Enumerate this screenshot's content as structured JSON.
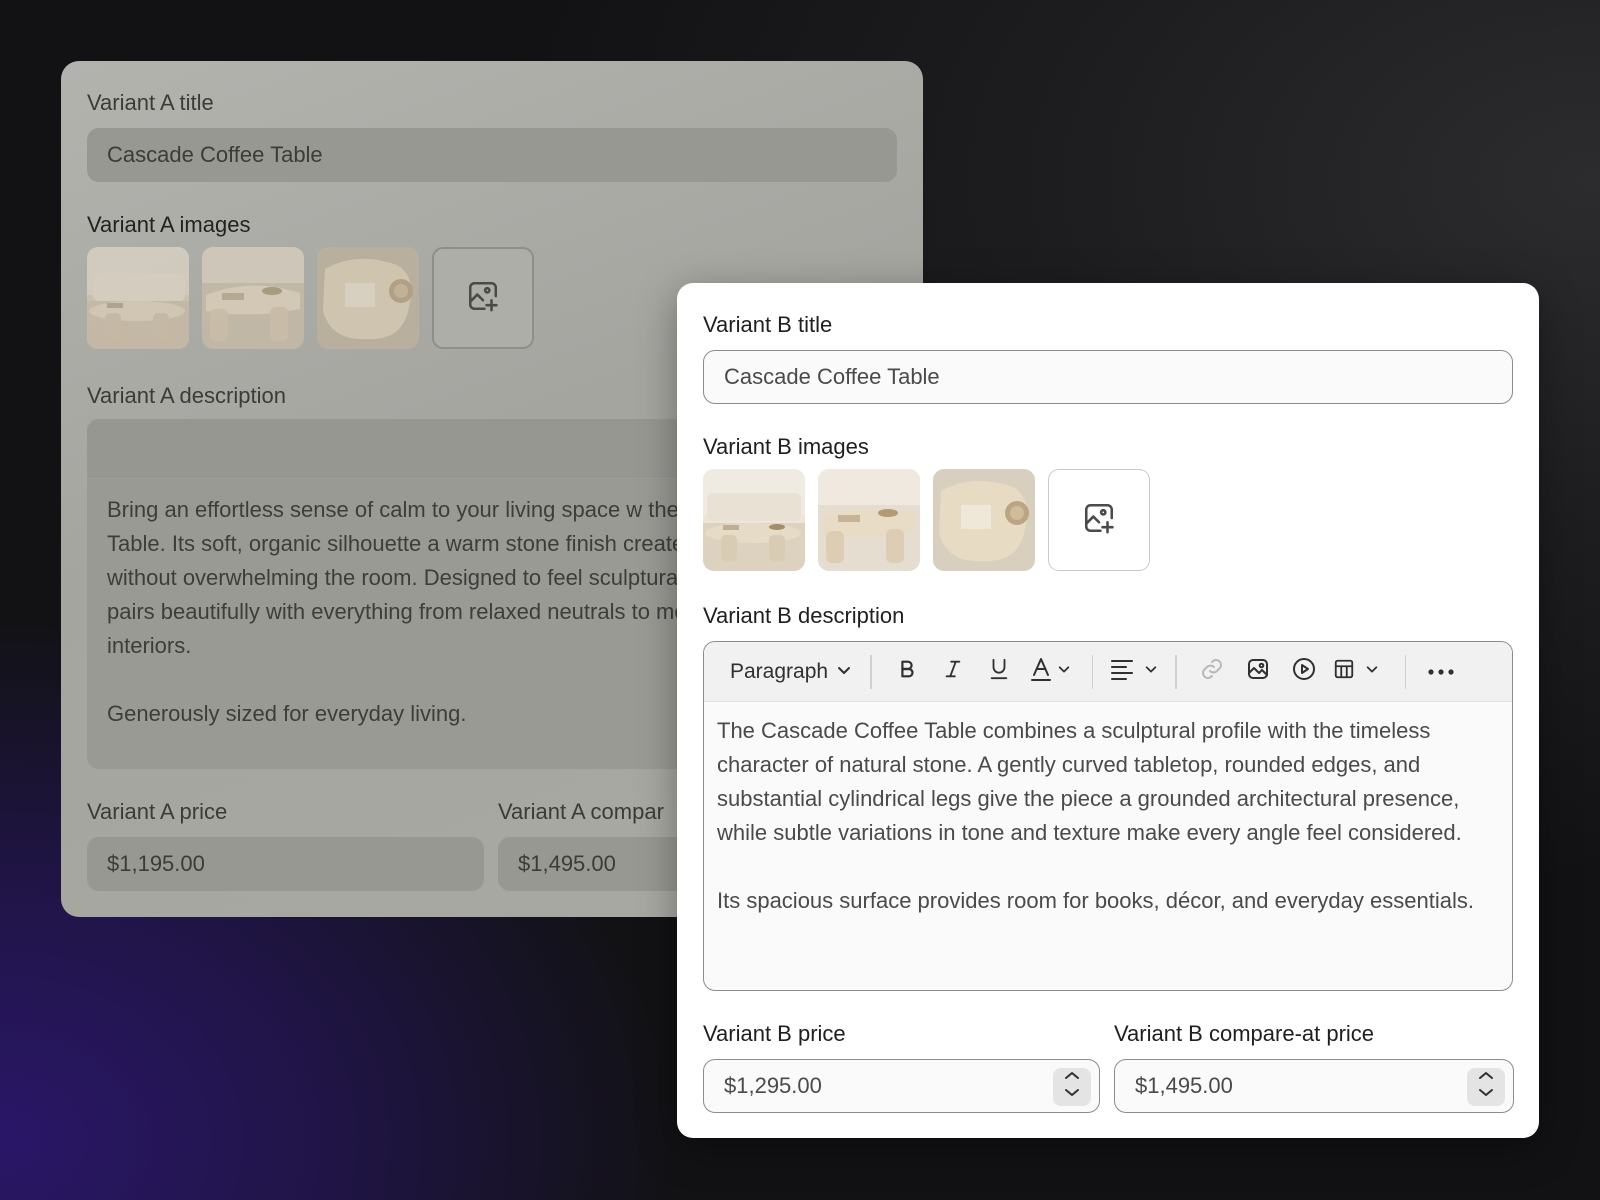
{
  "variant_a": {
    "title_label": "Variant A title",
    "title_value": "Cascade Coffee Table",
    "images_label": "Variant A images",
    "description_label": "Variant A description",
    "description_paragraphs": [
      "Bring an effortless sense of calm to your living space w the Cascade Coffee Table. Its soft, organic silhouette a warm stone finish create a natural focal point without overwhelming the room. Designed to feel sculptural ye inviting, Cascade pairs beautifully with everything from relaxed neutrals to more contemporary interiors.",
      "Generously sized for everyday living."
    ],
    "price_label": "Variant A price",
    "price_value": "$1,195.00",
    "compare_label": "Variant A compar",
    "compare_value": "$1,495.00"
  },
  "variant_b": {
    "title_label": "Variant B title",
    "title_value": "Cascade Coffee Table",
    "images_label": "Variant B images",
    "description_label": "Variant B description",
    "toolbar": {
      "paragraph_label": "Paragraph",
      "bold_icon": "bold-icon",
      "italic_icon": "italic-icon",
      "underline_icon": "underline-icon",
      "text_color_icon": "text-color-icon",
      "align_icon": "align-left-icon",
      "link_icon": "link-icon",
      "image_icon": "image-icon",
      "video_icon": "play-icon",
      "table_icon": "table-icon",
      "more_icon": "more-horizontal-icon"
    },
    "description_paragraphs": [
      "The Cascade Coffee Table combines a sculptural profile with the timeless character of natural stone. A gently curved tabletop, rounded edges, and substantial cylindrical legs give the piece a grounded architectural presence, while subtle variations in tone and texture make every angle feel considered.",
      "Its spacious surface provides room for books, décor, and everyday essentials."
    ],
    "price_label": "Variant B price",
    "price_value": "$1,295.00",
    "compare_label": "Variant B compare-at price",
    "compare_value": "$1,495.00"
  },
  "icons": {
    "add_image": "add-image-icon",
    "stepper": "chevron-up-down-icon"
  }
}
